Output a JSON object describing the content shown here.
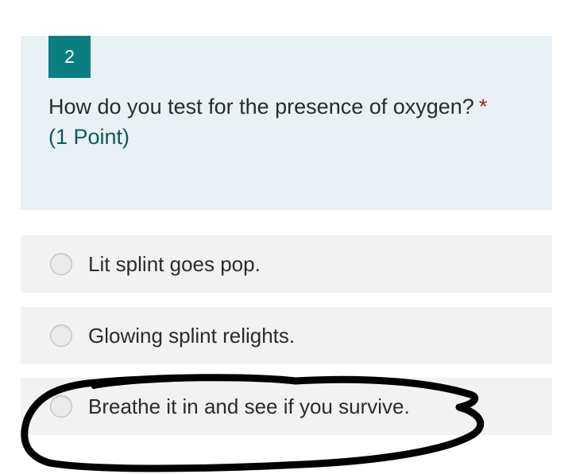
{
  "question": {
    "number": "2",
    "text": "How do you test for the presence of oxygen?",
    "required_marker": "*",
    "points": "(1 Point)"
  },
  "options": [
    {
      "label": "Lit splint goes pop.",
      "selected": false
    },
    {
      "label": "Glowing splint relights.",
      "selected": false
    },
    {
      "label": "Breathe it in and see if you survive.",
      "selected": false
    }
  ],
  "colors": {
    "accent": "#0a7f82",
    "card_background": "#e9f1f4",
    "option_background": "#f2f2f2",
    "required": "#a4262c",
    "scribble": "#000000"
  }
}
